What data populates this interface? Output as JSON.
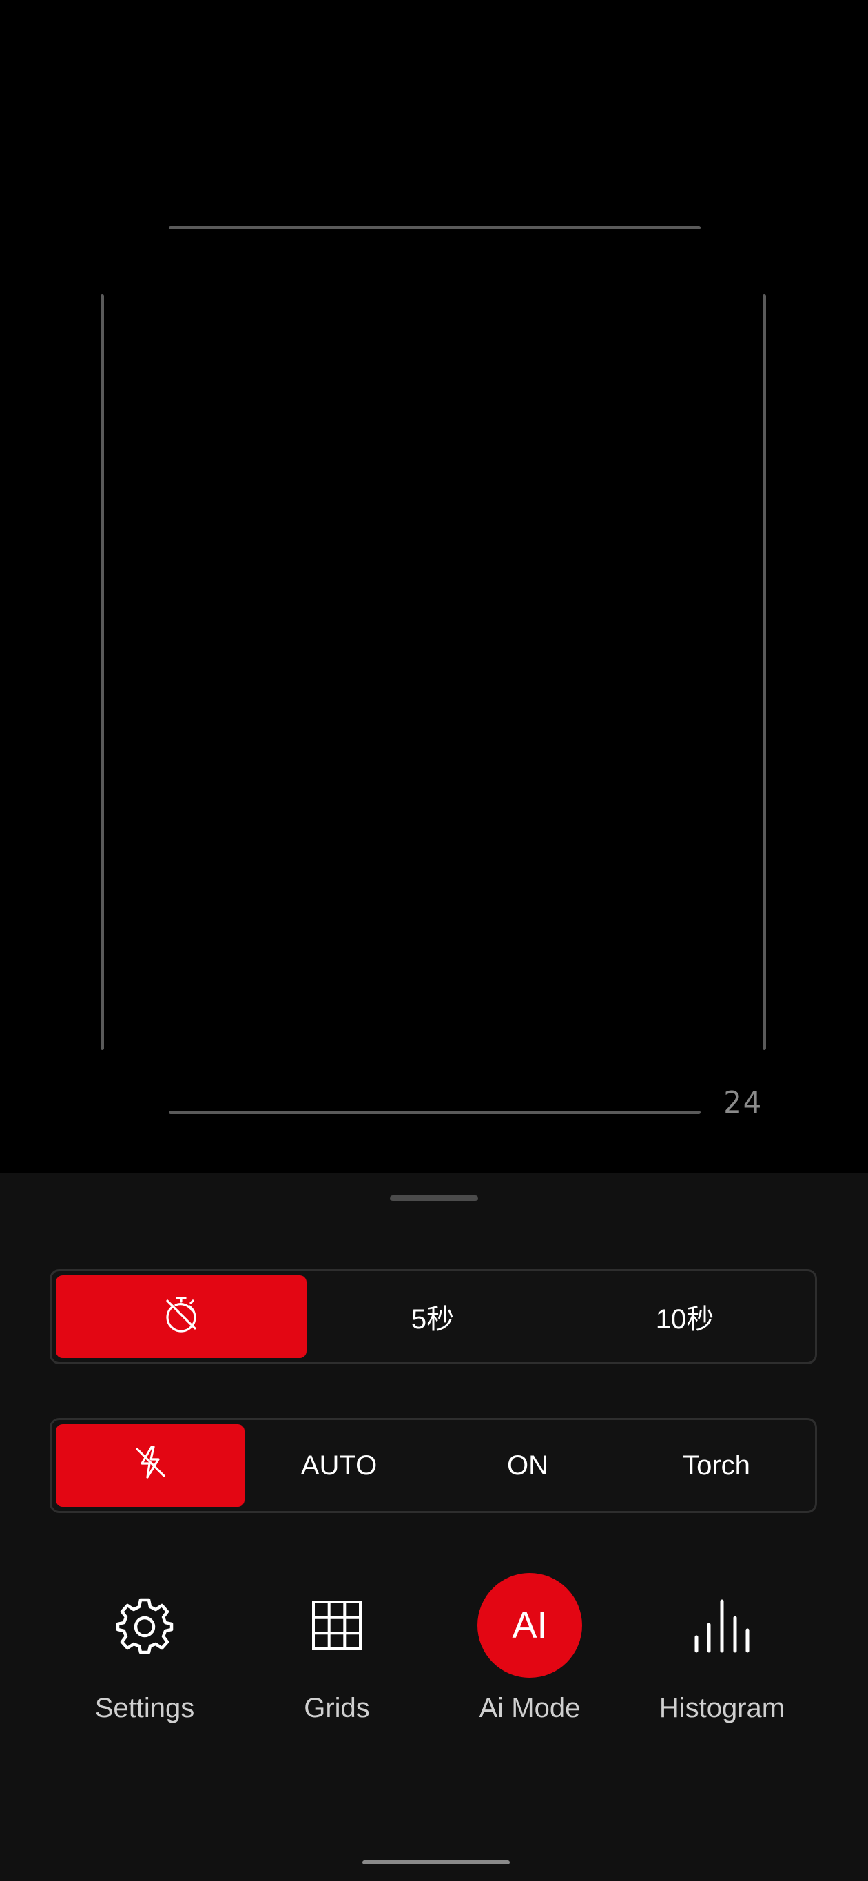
{
  "viewfinder": {
    "frame_count": "24"
  },
  "timer": {
    "options": [
      {
        "icon": "timer-off-icon",
        "label": ""
      },
      {
        "label": "5秒"
      },
      {
        "label": "10秒"
      }
    ],
    "selected_index": 0
  },
  "flash": {
    "options": [
      {
        "icon": "flash-off-icon",
        "label": ""
      },
      {
        "label": "AUTO"
      },
      {
        "label": "ON"
      },
      {
        "label": "Torch"
      }
    ],
    "selected_index": 0
  },
  "tools": {
    "settings": {
      "label": "Settings",
      "icon": "gear-icon"
    },
    "grids": {
      "label": "Grids",
      "icon": "grid-icon"
    },
    "ai_mode": {
      "label": "Ai Mode",
      "badge": "AI"
    },
    "histogram": {
      "label": "Histogram",
      "icon": "histogram-icon"
    }
  },
  "colors": {
    "accent": "#e30613",
    "sheet_background": "#111111"
  }
}
